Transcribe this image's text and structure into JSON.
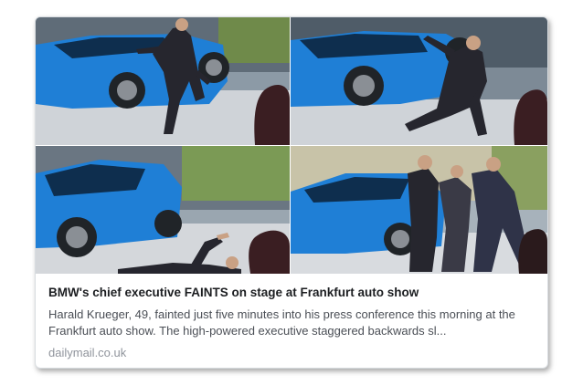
{
  "card": {
    "title": "BMW's chief executive FAINTS on stage at Frankfurt auto show",
    "description": "Harald Krueger, 49, fainted just five minutes into his press conference this morning at the Frankfurt auto show. The high-powered executive staggered backwards sl...",
    "source": "dailymail.co.uk"
  },
  "colors": {
    "car_blue": "#1f7fd6",
    "stage_floor": "#d6d8dc",
    "suit": "#2a2a33",
    "title_text": "#1c1e21",
    "desc_text": "#4b4f56",
    "source_text": "#90949c"
  }
}
